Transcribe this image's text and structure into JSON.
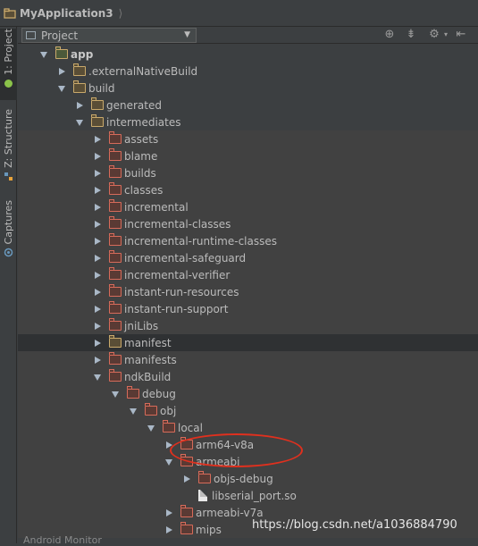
{
  "breadcrumb": {
    "project": "MyApplication3"
  },
  "sidebar": {
    "tabs": [
      {
        "label": "1: Project"
      },
      {
        "label": "Z: Structure"
      },
      {
        "label": "Captures"
      }
    ]
  },
  "panel": {
    "view_label": "Project"
  },
  "tree": {
    "rows": [
      {
        "label": "app"
      },
      {
        "label": ".externalNativeBuild"
      },
      {
        "label": "build"
      },
      {
        "label": "generated"
      },
      {
        "label": "intermediates"
      },
      {
        "label": "assets"
      },
      {
        "label": "blame"
      },
      {
        "label": "builds"
      },
      {
        "label": "classes"
      },
      {
        "label": "incremental"
      },
      {
        "label": "incremental-classes"
      },
      {
        "label": "incremental-runtime-classes"
      },
      {
        "label": "incremental-safeguard"
      },
      {
        "label": "incremental-verifier"
      },
      {
        "label": "instant-run-resources"
      },
      {
        "label": "instant-run-support"
      },
      {
        "label": "jniLibs"
      },
      {
        "label": "manifest"
      },
      {
        "label": "manifests"
      },
      {
        "label": "ndkBuild"
      },
      {
        "label": "debug"
      },
      {
        "label": "obj"
      },
      {
        "label": "local"
      },
      {
        "label": "arm64-v8a"
      },
      {
        "label": "armeabi"
      },
      {
        "label": "objs-debug"
      },
      {
        "label": "libserial_port.so"
      },
      {
        "label": "armeabi-v7a"
      },
      {
        "label": "mips"
      }
    ]
  },
  "bottom": {
    "label": "Android Monitor"
  },
  "watermark": "https://blog.csdn.net/a1036884790",
  "colors": {
    "background": "#3c3f41",
    "folder": "#d76b5a",
    "highlight": "#e0301e"
  }
}
